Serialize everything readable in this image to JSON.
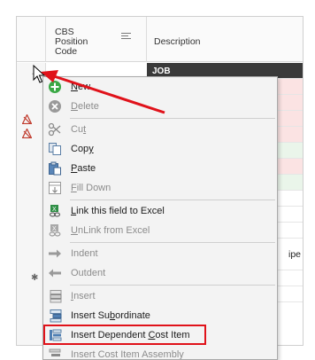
{
  "grid": {
    "columns": [
      {
        "label": "CBS\nPosition Code"
      },
      {
        "label": "Description"
      }
    ],
    "first_row_text": "JOB",
    "partial_cell_text": "ipe"
  },
  "context_menu": {
    "items": [
      {
        "label": "New",
        "key": "N",
        "enabled": true,
        "icon": "new-plus-icon"
      },
      {
        "label": "Delete",
        "key": "D",
        "enabled": false,
        "icon": "delete-x-icon"
      },
      {
        "label": "Cut",
        "key": "t",
        "enabled": false,
        "icon": "scissors-icon"
      },
      {
        "label": "Copy",
        "key": "y",
        "enabled": true,
        "icon": "copy-icon"
      },
      {
        "label": "Paste",
        "key": "P",
        "enabled": true,
        "icon": "paste-icon"
      },
      {
        "label": "Fill Down",
        "key": "F",
        "enabled": false,
        "icon": "fill-down-icon"
      },
      {
        "label": "Link this field to Excel",
        "key": "L",
        "enabled": true,
        "icon": "excel-link-icon"
      },
      {
        "label": "UnLink from Excel",
        "key": "U",
        "enabled": false,
        "icon": "excel-unlink-icon"
      },
      {
        "label": "Indent",
        "enabled": false,
        "icon": "indent-arrow-icon"
      },
      {
        "label": "Outdent",
        "enabled": false,
        "icon": "outdent-arrow-icon"
      },
      {
        "label": "Insert",
        "key": "I",
        "enabled": false,
        "icon": "insert-rows-icon"
      },
      {
        "label": "Insert Subordinate",
        "key": "b",
        "enabled": true,
        "icon": "insert-subordinate-icon"
      },
      {
        "label": "Insert Dependent Cost Item",
        "key": "C",
        "enabled": true,
        "icon": "insert-dependent-icon",
        "highlighted": true
      },
      {
        "label": "Insert Cost Item Assembly",
        "enabled": false,
        "icon": "insert-assembly-icon"
      }
    ]
  },
  "colors": {
    "annotation_red": "#e0121a",
    "header_row_dark": "#3a3a3a",
    "row_pink": "#fbe3e3",
    "row_green": "#eaf5ea",
    "menu_bg": "#f3f3f3"
  }
}
